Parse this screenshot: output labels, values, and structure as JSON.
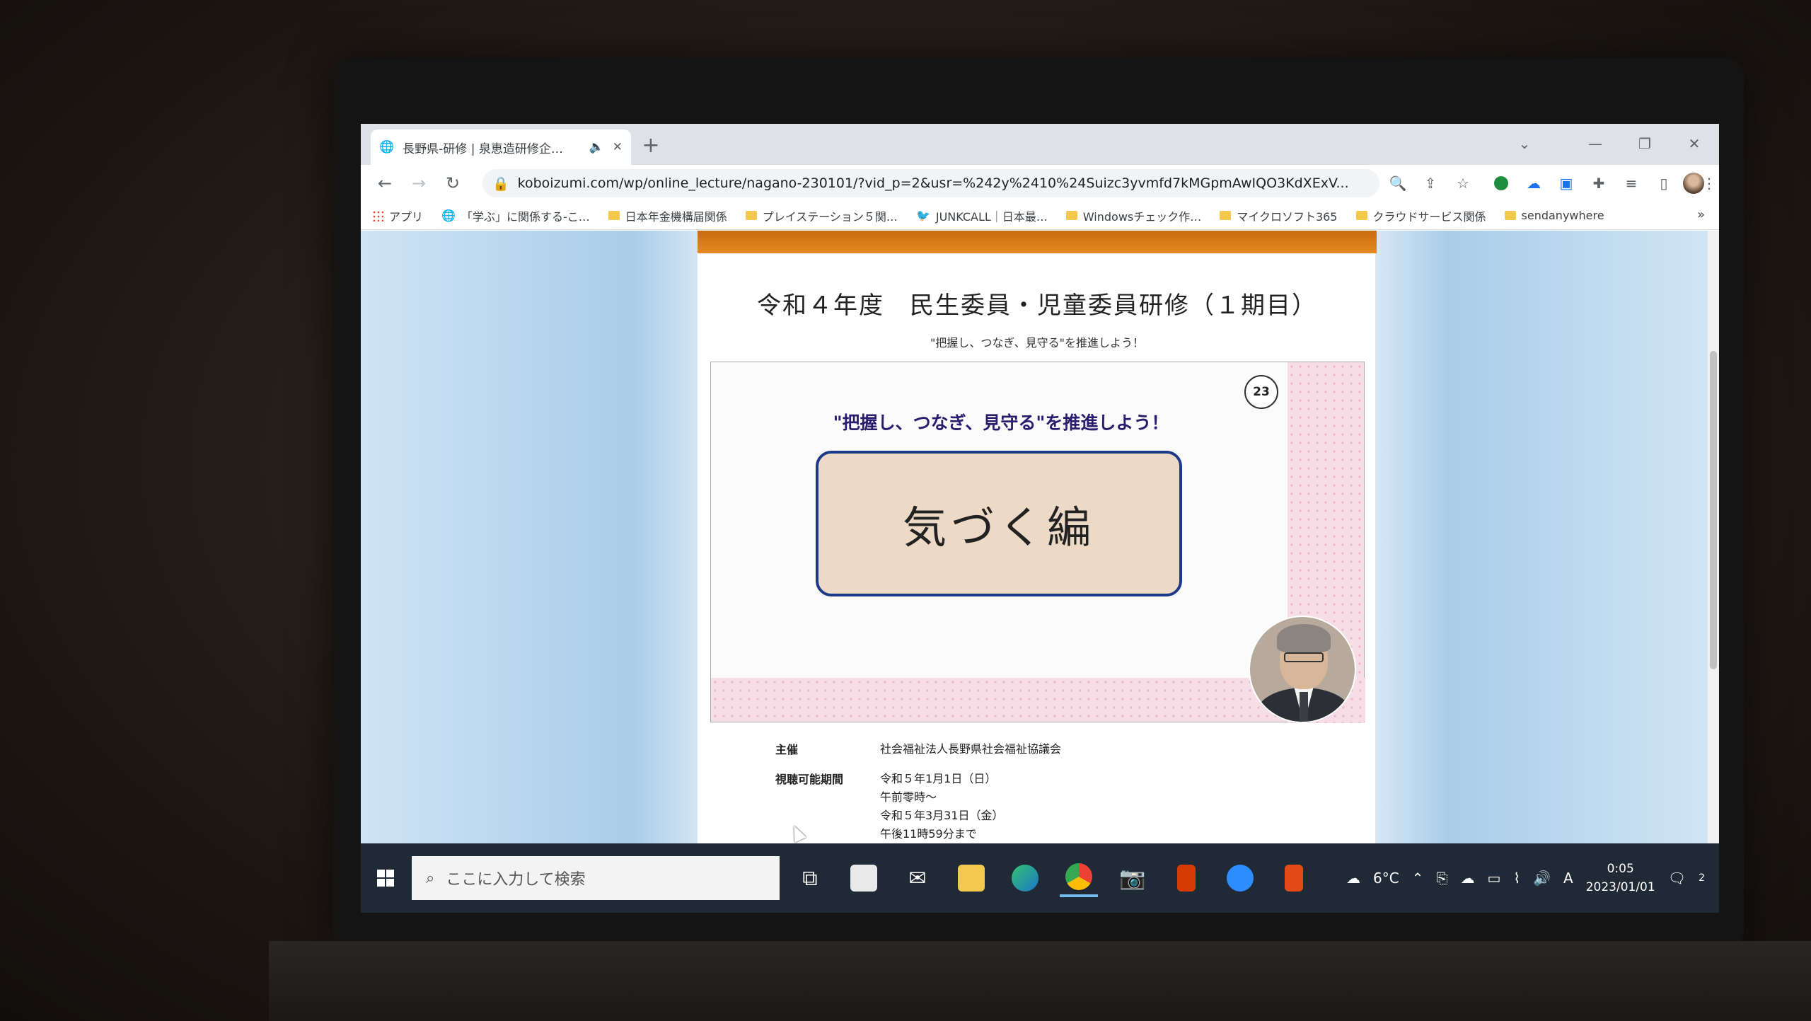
{
  "browser": {
    "tab_title": "長野県-研修 | 泉恵造研修企…",
    "url": "koboizumi.com/wp/online_lecture/nagano-230101/?vid_p=2&usr=%242y%2410%24Suizc3yvmfd7kMGpmAwIQO3KdXExV...",
    "bookmarks": [
      {
        "label": "アプリ",
        "icon": "apps-icon"
      },
      {
        "label": "「学ぶ」に関係する-こ…",
        "icon": "globe-icon"
      },
      {
        "label": "日本年金機構届関係",
        "icon": "folder-icon"
      },
      {
        "label": "プレイステーション５関…",
        "icon": "folder-icon"
      },
      {
        "label": "JUNKCALL｜日本最…",
        "icon": "bird-icon"
      },
      {
        "label": "Windowsチェック作…",
        "icon": "folder-icon"
      },
      {
        "label": "マイクロソフト365",
        "icon": "folder-icon"
      },
      {
        "label": "クラウドサービス関係",
        "icon": "folder-icon"
      },
      {
        "label": "sendanywhere",
        "icon": "folder-icon"
      }
    ],
    "bookmarks_more": "»"
  },
  "page": {
    "title": "令和４年度　民生委員・児童委員研修（１期目）",
    "subtitle": "\"把握し、つなぎ、見守る\"を推進しよう！",
    "slide": {
      "number": "23",
      "caption": "\"把握し、つなぎ、見守る\"を推進しよう！",
      "box_text": "気づく編"
    },
    "info": {
      "organizer_label": "主催",
      "organizer_value": "社会福祉法人長野県社会福祉協議会",
      "period_label": "視聴可能期間",
      "period_lines": [
        "令和５年1月1日（日）",
        "午前零時～",
        "令和５年3月31日（金）",
        "午後11時59分まで"
      ]
    }
  },
  "taskbar": {
    "search_placeholder": "ここに入力して検索",
    "weather": "6°C",
    "ime": "A",
    "time": "0:05",
    "date": "2023/01/01",
    "notifications": "2"
  },
  "colors": {
    "orange_bar": "#e58a1f",
    "slide_box_border": "#1d3a8a",
    "slide_box_fill": "#ecd9c6",
    "caption_text": "#2b1d6e"
  }
}
